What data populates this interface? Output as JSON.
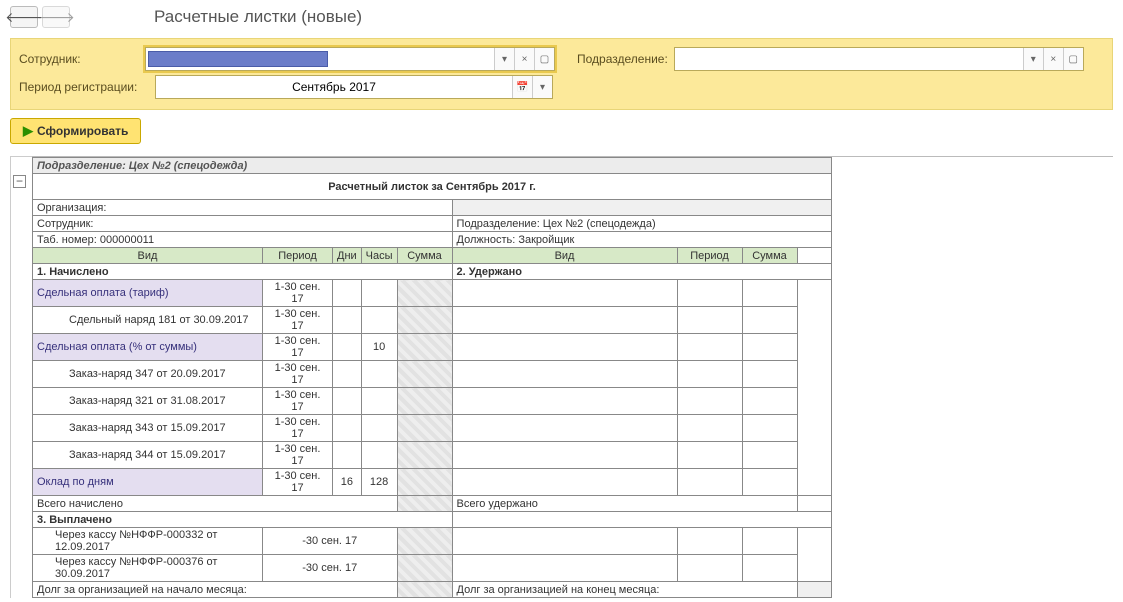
{
  "title": "Расчетные листки (новые)",
  "filters": {
    "employee_label": "Сотрудник:",
    "department_label": "Подразделение:",
    "period_label": "Период регистрации:",
    "period_value": "Сентябрь 2017"
  },
  "buttons": {
    "generate": "Сформировать"
  },
  "report": {
    "header": "Подразделение: Цех №2 (спецодежда)",
    "title": "Расчетный листок за Сентябрь 2017 г.",
    "info": {
      "org_label": "Организация:",
      "emp_label": "Сотрудник:",
      "tab_label": "Таб. номер: 000000011",
      "dept": "Подразделение: Цех №2 (спецодежда)",
      "position": "Должность: Закройщик"
    },
    "cols": {
      "kind": "Вид",
      "period": "Период",
      "days": "Дни",
      "hours": "Часы",
      "sum": "Сумма"
    },
    "sections": {
      "accrued": "1. Начислено",
      "withheld": "2. Удержано",
      "paid": "3. Выплачено",
      "total_accrued": "Всего начислено",
      "total_withheld": "Всего удержано",
      "debt_start": "Долг за организацией на начало месяца:",
      "debt_end": "Долг за организацией на конец месяца:"
    },
    "rows": [
      {
        "name": "Сдельная оплата (тариф)",
        "period": "1-30 сен. 17",
        "days": "",
        "hours": "",
        "class": "lilac"
      },
      {
        "name": "Сдельный наряд 181 от 30.09.2017",
        "period": "1-30 сен. 17",
        "days": "",
        "hours": "",
        "ind": 2
      },
      {
        "name": "Сдельная оплата (% от суммы)",
        "period": "1-30 сен. 17",
        "days": "",
        "hours": "10",
        "class": "lilac"
      },
      {
        "name": "Заказ-наряд 347 от 20.09.2017",
        "period": "1-30 сен. 17",
        "days": "",
        "hours": "",
        "ind": 2
      },
      {
        "name": "Заказ-наряд 321 от 31.08.2017",
        "period": "1-30 сен. 17",
        "days": "",
        "hours": "",
        "ind": 2
      },
      {
        "name": "Заказ-наряд 343 от 15.09.2017",
        "period": "1-30 сен. 17",
        "days": "",
        "hours": "",
        "ind": 2
      },
      {
        "name": "Заказ-наряд 344 от 15.09.2017",
        "period": "1-30 сен. 17",
        "days": "",
        "hours": "",
        "ind": 2
      },
      {
        "name": "Оклад по дням",
        "period": "1-30 сен. 17",
        "days": "16",
        "hours": "128",
        "class": "lilac"
      }
    ],
    "paid_rows": [
      {
        "name": "Через кассу  №НФФР-000332 от 12.09.2017",
        "period": "-30 сен. 17"
      },
      {
        "name": "Через кассу  №НФФР-000376 от 30.09.2017",
        "period": "-30 сен. 17"
      }
    ]
  }
}
